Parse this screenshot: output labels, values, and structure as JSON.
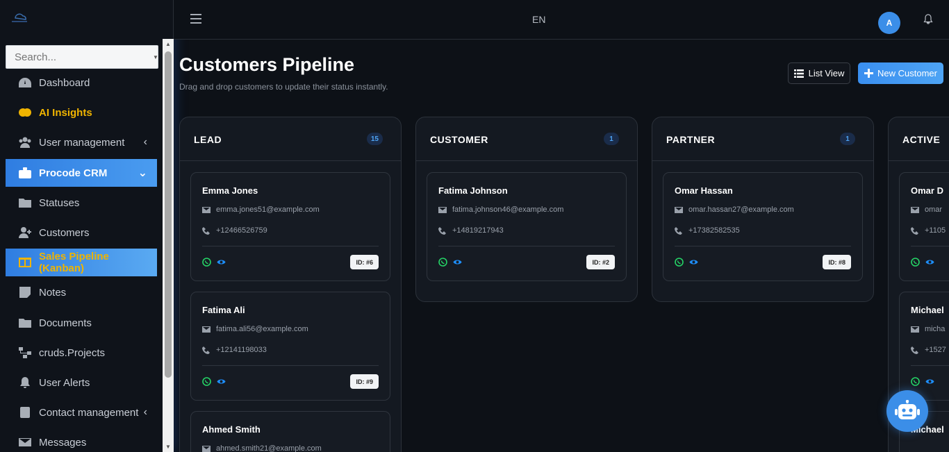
{
  "sidebar": {
    "search_placeholder": "Search...",
    "items": [
      {
        "label": "Dashboard",
        "icon": "gauge-icon"
      },
      {
        "label": "AI Insights",
        "icon": "brain-icon"
      },
      {
        "label": "User management",
        "icon": "users-icon"
      },
      {
        "label": "Procode CRM",
        "icon": "briefcase-icon"
      },
      {
        "label": "Statuses",
        "icon": "folder-icon"
      },
      {
        "label": "Customers",
        "icon": "user-plus-icon"
      },
      {
        "label": "Sales Pipeline (Kanban)",
        "icon": "columns-icon"
      },
      {
        "label": "Notes",
        "icon": "note-icon"
      },
      {
        "label": "Documents",
        "icon": "folder-icon"
      },
      {
        "label": "cruds.Projects",
        "icon": "sitemap-icon"
      },
      {
        "label": "User Alerts",
        "icon": "bell-icon"
      },
      {
        "label": "Contact management",
        "icon": "contact-book-icon"
      },
      {
        "label": "Messages",
        "icon": "envelope-icon"
      }
    ]
  },
  "topbar": {
    "language": "EN",
    "avatar_initial": "A"
  },
  "main": {
    "title": "Customers Pipeline",
    "subtitle": "Drag and drop customers to update their status instantly.",
    "list_view_label": "List View",
    "new_customer_label": "New Customer"
  },
  "columns": [
    {
      "title": "LEAD",
      "count": "15",
      "cards": [
        {
          "name": "Emma Jones",
          "email": "emma.jones51@example.com",
          "phone": "+12466526759",
          "id": "ID: #6"
        },
        {
          "name": "Fatima Ali",
          "email": "fatima.ali56@example.com",
          "phone": "+12141198033",
          "id": "ID: #9"
        },
        {
          "name": "Ahmed Smith",
          "email": "ahmed.smith21@example.com",
          "phone": "",
          "id": ""
        }
      ]
    },
    {
      "title": "CUSTOMER",
      "count": "1",
      "cards": [
        {
          "name": "Fatima Johnson",
          "email": "fatima.johnson46@example.com",
          "phone": "+14819217943",
          "id": "ID: #2"
        }
      ]
    },
    {
      "title": "PARTNER",
      "count": "1",
      "cards": [
        {
          "name": "Omar Hassan",
          "email": "omar.hassan27@example.com",
          "phone": "+17382582535",
          "id": "ID: #8"
        }
      ]
    },
    {
      "title": "ACTIVE",
      "count": "",
      "cards": [
        {
          "name": "Omar D",
          "email": "omar",
          "phone": "+1105",
          "id": ""
        },
        {
          "name": "Michael",
          "email": "micha",
          "phone": "+1527",
          "id": ""
        },
        {
          "name": "Michael",
          "email": "",
          "phone": "",
          "id": ""
        }
      ]
    }
  ],
  "colors": {
    "accent": "#3b8ee8",
    "gold": "#f0b400",
    "background": "#0d1117"
  }
}
